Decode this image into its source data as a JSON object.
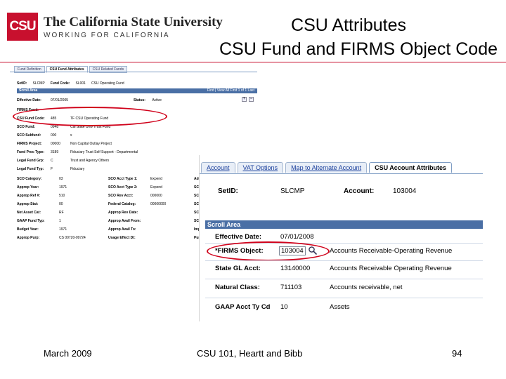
{
  "header": {
    "logo_mark": "CSU",
    "logo_title": "The California State University",
    "logo_subtitle": "WORKING FOR CALIFORNIA",
    "title_line1": "CSU Attributes",
    "title_line2": "CSU Fund and FIRMS Object Code"
  },
  "shot1": {
    "tabs": [
      "Fund Definition",
      "CSU Fund Attributes",
      "CSU Related Funds"
    ],
    "header": {
      "setid_label": "SetID:",
      "setid_value": "SLCMP",
      "fund_label": "Fund Code:",
      "fund_value": "SL001",
      "fund_desc": "CSU Operating Fund"
    },
    "scroll": {
      "title": "Scroll Area",
      "nav": "Find | View All    First  1 of 1  Last"
    },
    "rows": [
      {
        "label": "Effective Date:",
        "value": "07/01/2005",
        "desc": ""
      },
      {
        "label": "FIRMS Fund:",
        "value": "",
        "desc": ""
      },
      {
        "label": "CSU Fund Code:",
        "value": "485",
        "desc": "TF CSU Operating Fund"
      },
      {
        "label": "SCO Fund:",
        "value": "0948",
        "desc": "Cal State Univ Trust Fund"
      },
      {
        "label": "SCO Subfund:",
        "value": "000",
        "desc": "x"
      },
      {
        "label": "FIRMS Project:",
        "value": "00000",
        "desc": "Non Capital Outlay Project"
      },
      {
        "label": "Fund Proc Type:",
        "value": "3189",
        "desc": "Fiduciary Trust Self Support - Departmental"
      },
      {
        "label": "Legal Fund Grp:",
        "value": "C",
        "desc": "Trust and Agency Others"
      },
      {
        "label": "Legal Fund Typ:",
        "value": "F",
        "desc": "Fiduciary"
      }
    ],
    "status_label": "Status:",
    "status_value": "Active",
    "left2": [
      {
        "label": "SCO Category:",
        "value": "03"
      },
      {
        "label": "Approp Year:",
        "value": "1971"
      },
      {
        "label": "Approp Ref #:",
        "value": "510"
      },
      {
        "label": "Approp Stat:",
        "value": "00"
      },
      {
        "label": "Net Asset Cat:",
        "value": "RF"
      },
      {
        "label": "GAAP Fund Typ:",
        "value": "1"
      },
      {
        "label": "Budget Year:",
        "value": "1971"
      },
      {
        "label": "Approp Purp:",
        "value": "CS 00720-09724"
      }
    ],
    "right2": [
      {
        "label": "SCO Acct Type 1:",
        "value": "Expend"
      },
      {
        "label": "SCO Acct Type 2:",
        "value": "Expend"
      },
      {
        "label": "SCO Rev Acct:",
        "value": "000000"
      },
      {
        "label": "Federal Catalog:",
        "value": "00000000"
      },
      {
        "label": "Approp Rev Date:",
        "value": ""
      },
      {
        "label": "Approp Avail From:",
        "value": ""
      },
      {
        "label": "Approp Avail To:",
        "value": ""
      },
      {
        "label": "Usage Effect Dt:",
        "value": ""
      }
    ],
    "right3": [
      "Add",
      "SCO",
      "SCO",
      "SCO",
      "SCO",
      "SCO",
      "Imp",
      "Purr"
    ]
  },
  "shot2": {
    "tabs": [
      "Account",
      "VAT Options",
      "Map to Alternate Account",
      "CSU Account Attributes"
    ],
    "setid_label": "SetID:",
    "setid_value": "SLCMP",
    "account_label": "Account:",
    "account_value": "103004",
    "scroll_title": "Scroll Area",
    "rows": [
      {
        "label": "Effective Date:",
        "value": "07/01/2008",
        "desc": ""
      },
      {
        "label": "*FIRMS Object:",
        "value": "103004",
        "desc": "Accounts Receivable-Operating Revenue"
      },
      {
        "label": "State GL Acct:",
        "value": "13140000",
        "desc": "Accounts Receivable Operating Revenue"
      },
      {
        "label": "Natural Class:",
        "value": "711103",
        "desc": "Accounts receivable, net"
      },
      {
        "label": "GAAP Acct Ty Cd",
        "value": "10",
        "desc": "Assets"
      }
    ]
  },
  "footer": {
    "date": "March 2009",
    "course": "CSU 101, Heartt and Bibb",
    "page": "94"
  },
  "colors": {
    "brand_red": "#c8102e",
    "scroll_bar": "#4a6fa5",
    "annotation_red": "#d0021b"
  }
}
